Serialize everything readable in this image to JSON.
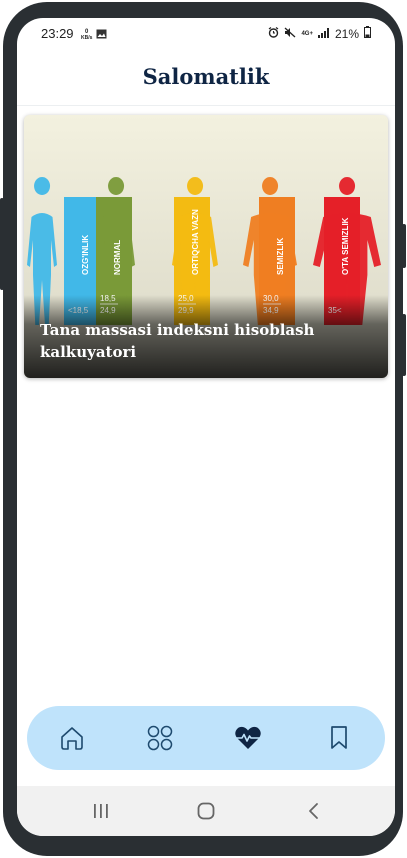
{
  "status_bar": {
    "time": "23:29",
    "net_speed_value": "0",
    "net_speed_unit": "KB/s",
    "network": "4G+",
    "battery": "21%",
    "icons": [
      "image-icon",
      "alarm-icon",
      "mute-icon",
      "signal-icon",
      "battery-icon"
    ]
  },
  "header": {
    "title": "Salomatlik"
  },
  "card": {
    "title": "Tana massasi indeksni hisoblash kalkuyatori",
    "image": {
      "categories": [
        {
          "label": "OZG'INLIK",
          "range_top": "",
          "range_bottom": "<18,5",
          "color": "#41b8e8"
        },
        {
          "label": "NORMAL",
          "range_top": "18,5",
          "range_bottom": "24,9",
          "color": "#7a9a38"
        },
        {
          "label": "ORTIQCHA VAZN",
          "range_top": "25,0",
          "range_bottom": "29,9",
          "color": "#f3bb12"
        },
        {
          "label": "SEMIZLIK",
          "range_top": "30,0",
          "range_bottom": "34,9",
          "color": "#ef7e22"
        },
        {
          "label": "O'TA SEMIZLIK",
          "range_top": "",
          "range_bottom": "35<",
          "color": "#e52028"
        }
      ]
    }
  },
  "bottom_nav": {
    "items": [
      {
        "name": "home",
        "icon": "home-icon",
        "active": false
      },
      {
        "name": "categories",
        "icon": "grid-icon",
        "active": false
      },
      {
        "name": "health",
        "icon": "heart-pulse-icon",
        "active": true
      },
      {
        "name": "bookmarks",
        "icon": "bookmark-icon",
        "active": false
      }
    ],
    "active_color": "#0f2544",
    "inactive_color": "#1e4a6e"
  },
  "system_nav": {
    "buttons": [
      "recent-apps-icon",
      "home-circle-icon",
      "back-icon"
    ]
  }
}
